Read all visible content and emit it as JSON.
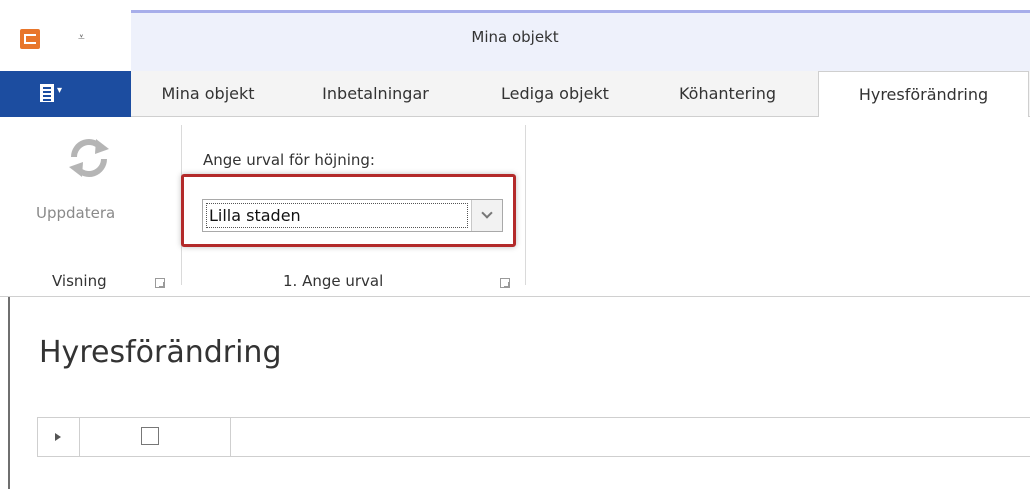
{
  "window": {
    "title": "Mina objekt"
  },
  "tabs": [
    {
      "label": "Mina objekt",
      "active": false
    },
    {
      "label": "Inbetalningar",
      "active": false
    },
    {
      "label": "Lediga objekt",
      "active": false
    },
    {
      "label": "Köhantering",
      "active": false
    },
    {
      "label": "Hyresförändring",
      "active": true
    }
  ],
  "ribbon": {
    "refresh_label": "Uppdatera",
    "visning_group": "Visning",
    "urval_label": "Ange urval för höjning:",
    "urval_value": "Lilla staden",
    "urval_group": "1. Ange urval"
  },
  "content": {
    "title": "Hyresförändring"
  },
  "colors": {
    "file_button": "#1c4da0",
    "app_icon": "#e8762b",
    "highlight": "#b32a2a",
    "title_bar_accent": "#a7aeea"
  }
}
